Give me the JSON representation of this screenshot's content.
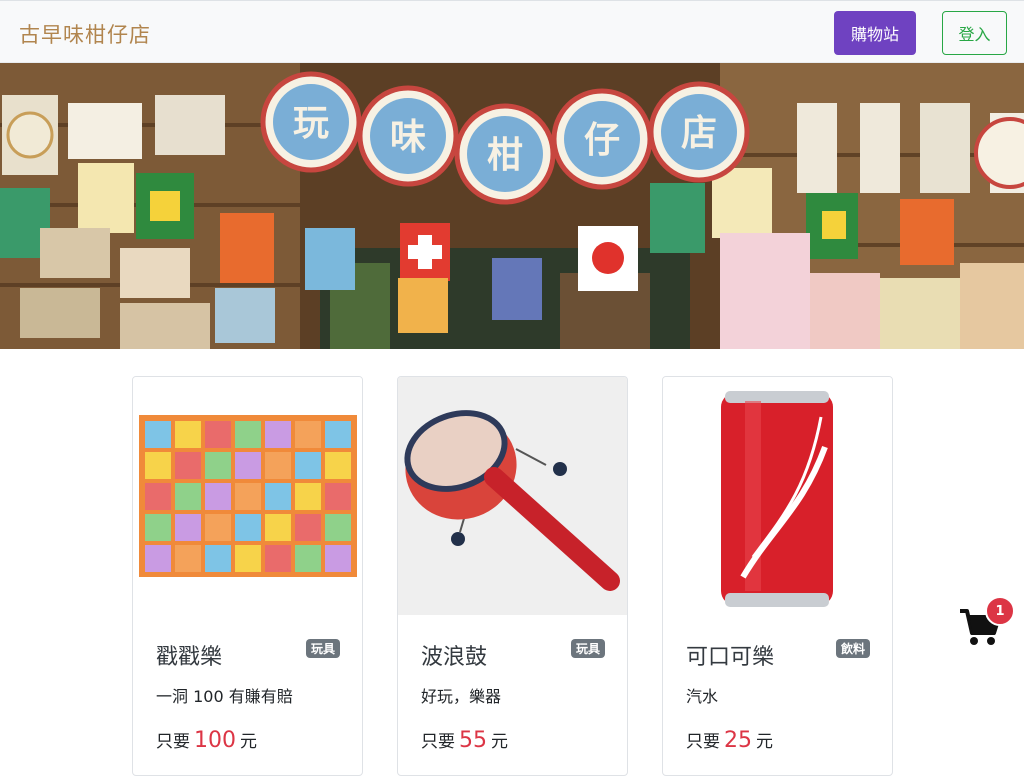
{
  "navbar": {
    "brand": "古早味柑仔店",
    "shop_label": "購物站",
    "login_label": "登入"
  },
  "banner": {
    "sign_chars": [
      "玩",
      "味",
      "柑",
      "仔",
      "店"
    ]
  },
  "products": [
    {
      "title": "戳戳樂",
      "badge": "玩具",
      "desc": "一洞 100 有賺有賠",
      "price_prefix": "只要",
      "price": "100",
      "price_suffix": "元"
    },
    {
      "title": "波浪鼓",
      "badge": "玩具",
      "desc": "好玩，樂器",
      "price_prefix": "只要",
      "price": "55",
      "price_suffix": "元"
    },
    {
      "title": "可口可樂",
      "badge": "飲料",
      "desc": "汽水",
      "price_prefix": "只要",
      "price": "25",
      "price_suffix": "元"
    }
  ],
  "cart": {
    "count": "1",
    "icon": "shopping-cart-icon"
  },
  "colors": {
    "brand": "#b1854e",
    "shop": "#6f42c1",
    "login": "#28a745",
    "price": "#dc3545",
    "badge": "#6c757d"
  }
}
